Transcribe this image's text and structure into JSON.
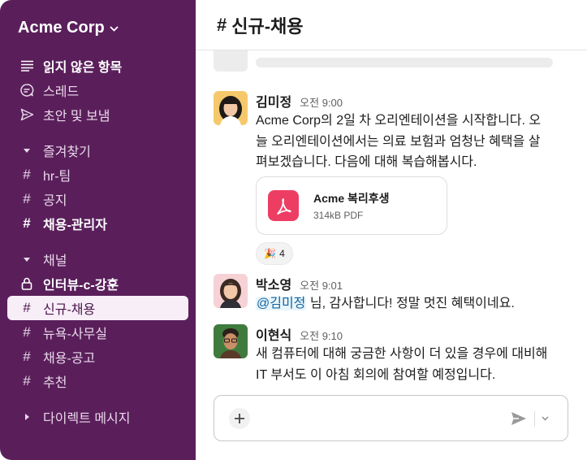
{
  "workspace": {
    "name": "Acme Corp",
    "chevron_icon": "chevron-down-icon"
  },
  "sidebar": {
    "top_items": [
      {
        "label": "읽지 않은 항목",
        "icon": "list-icon",
        "bold": true
      },
      {
        "label": "스레드",
        "icon": "threads-icon",
        "bold": false
      },
      {
        "label": "초안 및 보냄",
        "icon": "send-icon",
        "bold": false
      }
    ],
    "favorites": {
      "header": "즐겨찾기",
      "items": [
        {
          "label": "hr-팀",
          "bold": false
        },
        {
          "label": "공지",
          "bold": false
        },
        {
          "label": "채용-관리자",
          "bold": true
        }
      ]
    },
    "channels": {
      "header": "채널",
      "items": [
        {
          "label": "인터뷰-c-강훈",
          "icon": "lock-icon",
          "bold": true
        },
        {
          "label": "신규-채용",
          "icon": "hash-icon",
          "active": true
        },
        {
          "label": "뉴욕-사무실",
          "icon": "hash-icon"
        },
        {
          "label": "채용-공고",
          "icon": "hash-icon"
        },
        {
          "label": "추천",
          "icon": "hash-icon"
        }
      ]
    },
    "direct_messages": {
      "header": "다이렉트 메시지"
    }
  },
  "channel": {
    "hash": "#",
    "name": "신규-채용"
  },
  "messages": [
    {
      "author": "김미정",
      "time": "오전 9:00",
      "lines": [
        "Acme Corp의 2일 차 오리엔테이션을 시작합니다. 오",
        "늘 오리엔테이션에서는 의료 보험과 엄청난 혜택을 살",
        "펴보겠습니다. 다음에 대해 복습해봅시다."
      ],
      "attachment": {
        "name": "Acme 복리후생",
        "meta": "314kB PDF",
        "icon": "pdf-icon"
      },
      "reaction": {
        "emoji": "🎉",
        "count": "4"
      }
    },
    {
      "author": "박소영",
      "time": "오전 9:01",
      "mention": "@김미정",
      "text": " 님, 감사합니다! 정말 멋진 혜택이네요."
    },
    {
      "author": "이현식",
      "time": "오전 9:10",
      "lines": [
        "새 컴퓨터에 대해 궁금한 사항이 더 있을 경우에 대비해",
        "IT 부서도 이 아침 회의에 참여할 예정입니다."
      ]
    }
  ],
  "composer": {
    "placeholder": "",
    "add_icon": "plus-icon",
    "send_icon": "send-icon",
    "options_icon": "chevron-down-icon"
  },
  "colors": {
    "sidebar": "#5a1f5b",
    "active_item": "#f8eef8",
    "pdf": "#ee3d63",
    "mention_bg": "#e8f5fa",
    "mention_text": "#1264a3"
  }
}
